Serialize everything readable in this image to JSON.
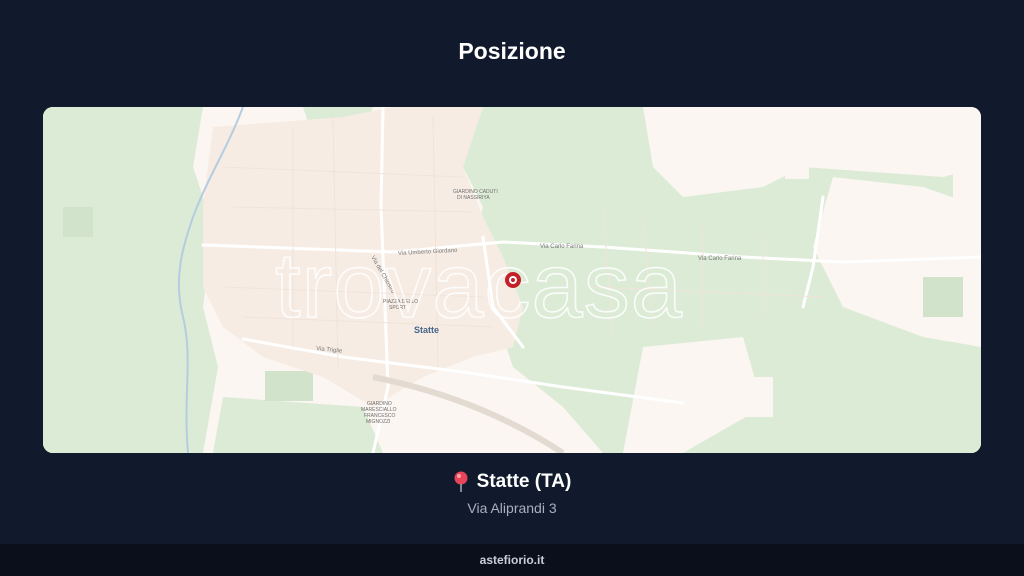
{
  "page": {
    "title": "Posizione"
  },
  "map": {
    "watermark": "trovacasa",
    "city_label": "Statte",
    "labels": {
      "giardini_caduti": "GIARDINO CADUTI",
      "giardini_caduti_2": "DI NASSIRIYA",
      "via_umberto": "Via Umberto Giordano",
      "via_carlo_farina_1": "Via Carlo Farina",
      "via_carlo_farina_2": "Via Carlo Farina",
      "piazza": "PIAZZA DELLO",
      "piazza_2": "SPORT",
      "via_triglie": "Via Triglie",
      "via_del_chiostro": "Via del Chiostro",
      "giardino_1": "GIARDINO",
      "giardino_2": "MARESCIALLO",
      "giardino_3": "FRANCESCO",
      "giardino_4": "MIGNOZZI"
    },
    "colors": {
      "land": "#fbf6f1",
      "vegetation": "#dcebd6",
      "marker": "#c4202a"
    }
  },
  "location": {
    "name": "Statte (TA)",
    "address": "Via Aliprandi 3",
    "pin_icon": "pin-icon"
  },
  "footer": {
    "site": "astefiorio.it"
  }
}
